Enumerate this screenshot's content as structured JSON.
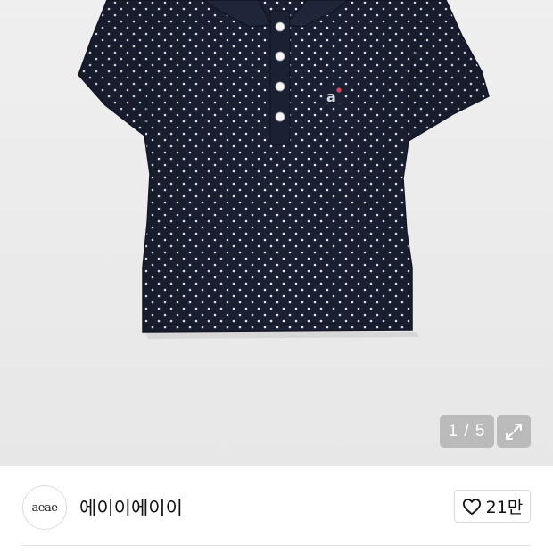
{
  "gallery": {
    "page_current": "1",
    "page_total": "5",
    "counter_text": "1 / 5",
    "expand_icon": "expand-icon",
    "image_subject": "navy-polka-dot-polo-shirt",
    "colors": {
      "shirt": "#1b2033",
      "dot": "#ffffff",
      "background": "#ececec"
    }
  },
  "seller": {
    "avatar_text": "aeae",
    "name": "에이이에이이"
  },
  "like": {
    "icon": "heart-outline-icon",
    "count": "21만"
  }
}
